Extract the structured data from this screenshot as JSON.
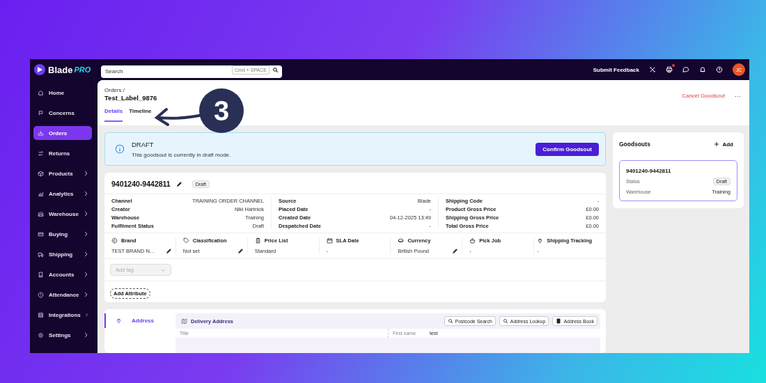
{
  "topbar": {
    "logo": {
      "name": "Blade",
      "suffix": "PRO"
    },
    "search": {
      "placeholder": "Search",
      "shortcut": "Cmd + SPACE"
    },
    "feedback": "Submit Feedback",
    "tools": [
      {
        "kind": "tools",
        "badge": false
      },
      {
        "kind": "printer",
        "badge": true
      },
      {
        "kind": "chat",
        "badge": false
      },
      {
        "kind": "bell",
        "badge": false
      },
      {
        "kind": "help",
        "badge": false
      }
    ],
    "avatar": "JC"
  },
  "sidebar": {
    "items": [
      {
        "label": "Home",
        "kind": "home",
        "expandable": false,
        "selected": false
      },
      {
        "label": "Concerns",
        "kind": "flag",
        "expandable": false,
        "selected": false
      },
      {
        "label": "Orders",
        "kind": "tray",
        "expandable": false,
        "selected": true
      },
      {
        "label": "Returns",
        "kind": "swap",
        "expandable": false,
        "selected": false
      },
      {
        "label": "Products",
        "kind": "cube",
        "expandable": true,
        "selected": false
      },
      {
        "label": "Analytics",
        "kind": "chart",
        "expandable": true,
        "selected": false
      },
      {
        "label": "Warehouse",
        "kind": "warehouse",
        "expandable": true,
        "selected": false
      },
      {
        "label": "Buying",
        "kind": "card",
        "expandable": true,
        "selected": false
      },
      {
        "label": "Shipping",
        "kind": "truck",
        "expandable": true,
        "selected": false
      },
      {
        "label": "Accounts",
        "kind": "book",
        "expandable": true,
        "selected": false
      },
      {
        "label": "Attendance",
        "kind": "clock",
        "expandable": true,
        "selected": false
      },
      {
        "label": "Integrations",
        "kind": "database",
        "expandable": true,
        "selected": false
      },
      {
        "label": "Settings",
        "kind": "gear",
        "expandable": true,
        "selected": false
      }
    ]
  },
  "header": {
    "breadcrumb": "Orders /",
    "title": "Test_Label_9876",
    "tabs": [
      {
        "label": "Details",
        "selected": true
      },
      {
        "label": "Timeline",
        "selected": false
      }
    ],
    "cancel": "Cancel Goodsout",
    "more": "···"
  },
  "banner": {
    "title": "DRAFT",
    "text": "This goodsout is currently in draft mode.",
    "button": "Confirm Goodsout"
  },
  "order": {
    "number": "9401240-9442811",
    "status": "Draft",
    "details": [
      [
        {
          "label": "Channel",
          "value": "TRAINING ORDER CHANNEL"
        },
        {
          "label": "Creator",
          "value": "Niki Hartnick"
        },
        {
          "label": "Warehouse",
          "value": "Training"
        },
        {
          "label": "Fulfilment Status",
          "value": "Draft"
        }
      ],
      [
        {
          "label": "Source",
          "value": "Blade"
        },
        {
          "label": "Placed Date",
          "value": "-"
        },
        {
          "label": "Created Date",
          "value": "04-12-2025 13:49"
        },
        {
          "label": "Despatched Date",
          "value": "-"
        }
      ],
      [
        {
          "label": "Shipping Code",
          "value": "-"
        },
        {
          "label": "Product Gross Price",
          "value": "£0.00"
        },
        {
          "label": "Shipping Gross Price",
          "value": "£0.00"
        },
        {
          "label": "Total Gross Price",
          "value": "£0.00"
        }
      ]
    ],
    "attributes": [
      {
        "label": "Brand",
        "kind": "copyright",
        "value": "TEST BRAND N...",
        "editable": true
      },
      {
        "label": "Classification",
        "kind": "tag",
        "value": "Not set",
        "editable": true
      },
      {
        "label": "Price List",
        "kind": "clipboard",
        "value": "Standard",
        "editable": false
      },
      {
        "label": "SLA Date",
        "kind": "calendar",
        "value": "-",
        "editable": false
      },
      {
        "label": "Currency",
        "kind": "coins",
        "value": "British Pound",
        "editable": true
      },
      {
        "label": "Pick Job",
        "kind": "basket",
        "value": "-",
        "editable": false
      },
      {
        "label": "Shipping Tracking",
        "kind": "pin",
        "value": "-",
        "editable": false
      }
    ],
    "tag_placeholder": "Add tag",
    "add_attribute": "Add Attribute"
  },
  "address": {
    "tab": "Address",
    "panel_title": "Delivery Address",
    "buttons": [
      {
        "label": "Postcode Search",
        "kind": "search"
      },
      {
        "label": "Address Lookup",
        "kind": "search"
      },
      {
        "label": "Address Book",
        "kind": "book"
      }
    ],
    "fields": [
      {
        "label": "Title"
      },
      {
        "label": "First name",
        "value": "test"
      }
    ]
  },
  "goodsouts": {
    "title": "Goodsouts",
    "add": "Add",
    "items": [
      {
        "number": "9401240-9442811",
        "status_label": "Status",
        "status": "Draft",
        "warehouse_label": "Warehouse",
        "warehouse": "Training",
        "selected": true
      }
    ]
  },
  "callout": {
    "number": "3"
  }
}
